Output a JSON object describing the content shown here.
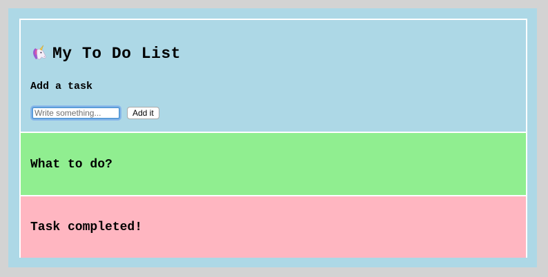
{
  "app": {
    "title": "My To Do List",
    "icon": "unicorn-icon"
  },
  "add_task": {
    "heading": "Add a task",
    "input_placeholder": "Write something...",
    "input_value": "",
    "button_label": "Add it"
  },
  "todo_section": {
    "heading": "What to do?"
  },
  "completed_section": {
    "heading": "Task completed!"
  },
  "colors": {
    "page_background": "#d3d3d3",
    "header_background": "#add8e6",
    "todo_background": "#90ee90",
    "completed_background": "#ffb6c1",
    "divider": "#ffffff"
  }
}
